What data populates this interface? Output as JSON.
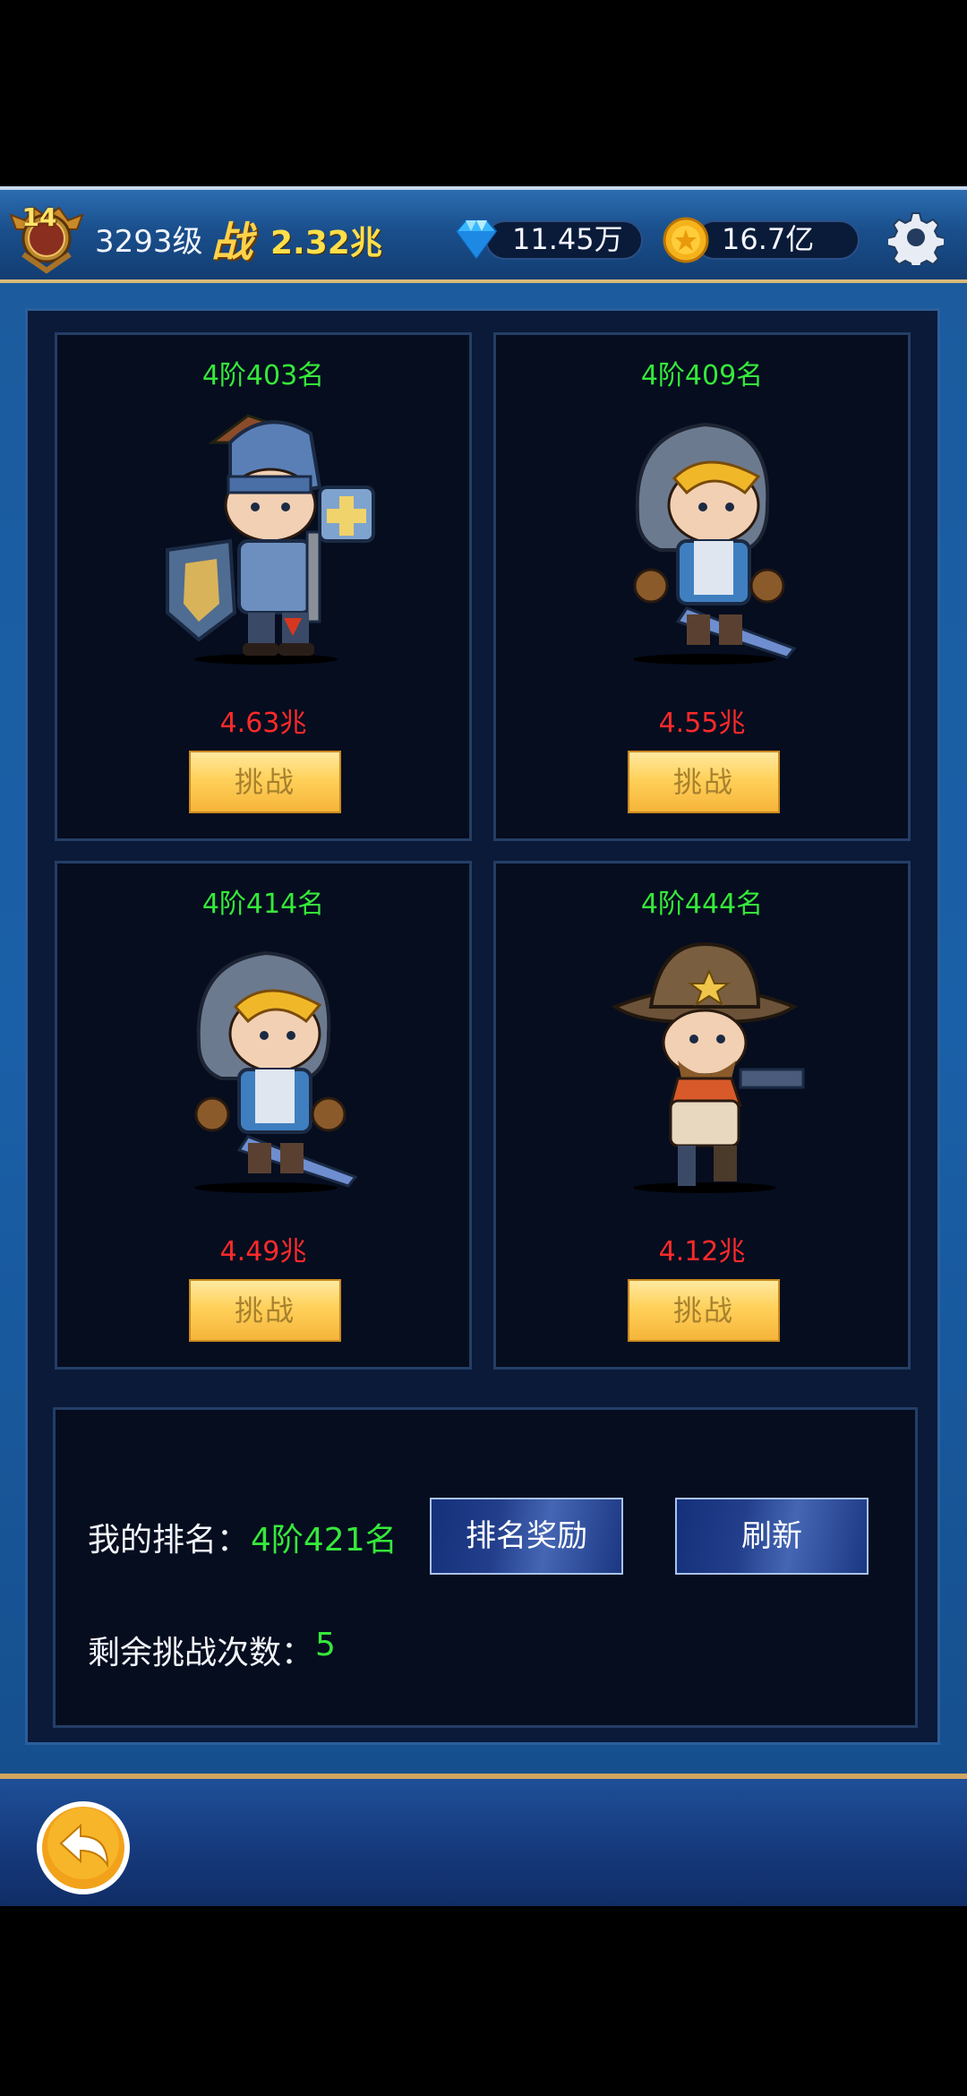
{
  "header": {
    "vip_level": "14",
    "player_level": "3293级",
    "power_icon_label": "战",
    "power_value": "2.32兆",
    "diamonds": "11.45万",
    "coins": "16.7亿",
    "icons": [
      "rank-badge-icon",
      "diamond-icon",
      "gold-coin-icon",
      "gear-icon"
    ]
  },
  "opponents": [
    {
      "rank": "4阶403名",
      "power": "4.63兆",
      "button": "挑战",
      "portrait": "knight-with-shield-and-hammer"
    },
    {
      "rank": "4阶409名",
      "power": "4.55兆",
      "button": "挑战",
      "portrait": "hooded-swordsman"
    },
    {
      "rank": "4阶414名",
      "power": "4.49兆",
      "button": "挑战",
      "portrait": "hooded-swordsman"
    },
    {
      "rank": "4阶444名",
      "power": "4.12兆",
      "button": "挑战",
      "portrait": "sheriff-gunslinger"
    }
  ],
  "info": {
    "my_rank_label": "我的排名：",
    "my_rank_value": "4阶421名",
    "remaining_label": "剩余挑战次数：",
    "remaining_value": "5",
    "rank_reward_button": "排名奖励",
    "refresh_button": "刷新"
  },
  "footer": {
    "back_icon": "back-arrow-icon"
  },
  "colors": {
    "rank_green": "#36e83a",
    "power_red": "#ff2a2a",
    "challenge_button": "#ffd15a",
    "frame_blue": "#1a60a8"
  }
}
